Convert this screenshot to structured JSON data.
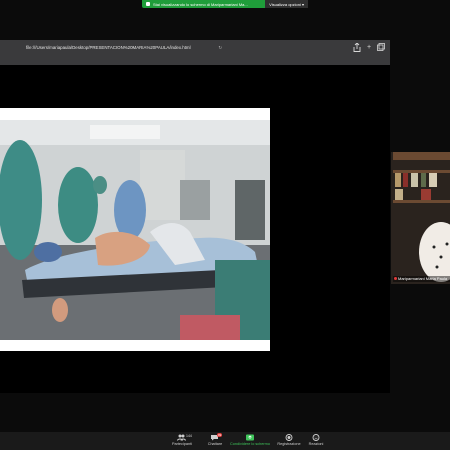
{
  "share_banner": {
    "message": "Stai visualizzando lo schermo di Mariparmariani Ma...",
    "view_options": "Visualizza opzioni ▾"
  },
  "browser": {
    "url": "file:///Users/mariapaula/Desktop/PRESENTACION%20MARIA%20PAULA/index.html",
    "icons": [
      "share-icon",
      "new-tab-icon",
      "tabs-overview-icon"
    ]
  },
  "participant": {
    "name": "Mariparmariani Maria Paula"
  },
  "toolbar": {
    "items": [
      {
        "label": "Partecipanti",
        "count": "144"
      },
      {
        "label": "Chattare",
        "badge": "99"
      },
      {
        "label": "Condividere lo schermo"
      },
      {
        "label": "Registrazione"
      },
      {
        "label": "Reazioni"
      }
    ]
  },
  "colors": {
    "share_green": "#1f9d3a",
    "toolbar_bg": "#1a1a1a",
    "browser_bar": "#3a3a3c"
  }
}
